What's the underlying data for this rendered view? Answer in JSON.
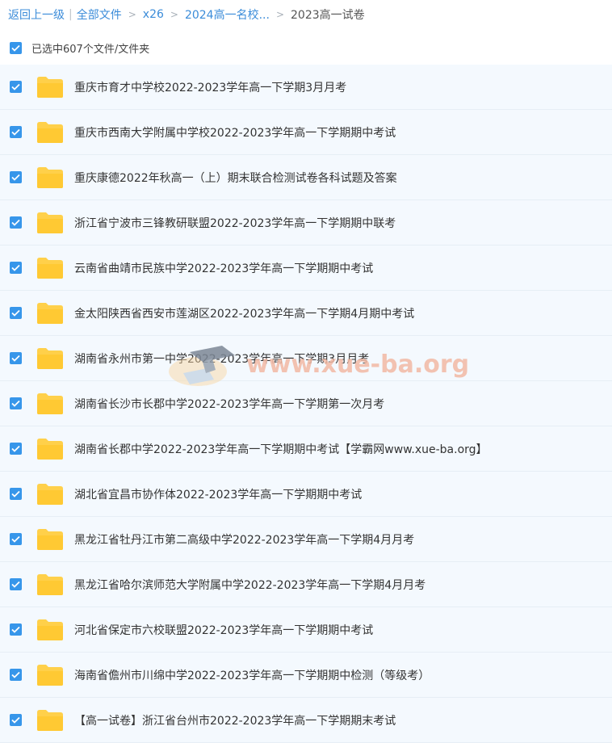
{
  "breadcrumb": {
    "back": "返回上一级",
    "all_files": "全部文件",
    "level1": "x26",
    "level2": "2024高一名校...",
    "current": "2023高一试卷",
    "separator": ">",
    "divider": "|"
  },
  "selection": {
    "count_label": "已选中607个文件/文件夹"
  },
  "files": [
    {
      "name": "重庆市育才中学校2022-2023学年高一下学期3月月考"
    },
    {
      "name": "重庆市西南大学附属中学校2022-2023学年高一下学期期中考试"
    },
    {
      "name": "重庆康德2022年秋高一（上）期末联合检测试卷各科试题及答案"
    },
    {
      "name": "浙江省宁波市三锋教研联盟2022-2023学年高一下学期期中联考"
    },
    {
      "name": "云南省曲靖市民族中学2022-2023学年高一下学期期中考试"
    },
    {
      "name": "金太阳陕西省西安市莲湖区2022-2023学年高一下学期4月期中考试"
    },
    {
      "name": "湖南省永州市第一中学2022-2023学年高一下学期3月月考"
    },
    {
      "name": "湖南省长沙市长郡中学2022-2023学年高一下学期第一次月考"
    },
    {
      "name": "湖南省长郡中学2022-2023学年高一下学期期中考试【学霸网www.xue-ba.org】"
    },
    {
      "name": "湖北省宜昌市协作体2022-2023学年高一下学期期中考试"
    },
    {
      "name": "黑龙江省牡丹江市第二高级中学2022-2023学年高一下学期4月月考"
    },
    {
      "name": "黑龙江省哈尔滨师范大学附属中学2022-2023学年高一下学期4月月考"
    },
    {
      "name": "河北省保定市六校联盟2022-2023学年高一下学期期中考试"
    },
    {
      "name": "海南省儋州市川绵中学2022-2023学年高一下学期期中检测（等级考）"
    },
    {
      "name": "【高一试卷】浙江省台州市2022-2023学年高一下学期期末考试"
    }
  ],
  "watermark": {
    "text": "www.xue-ba.org"
  },
  "colors": {
    "link": "#3b8cd9",
    "checkbox": "#3796ea",
    "folder": "#ffd04a",
    "row_bg": "#f4f9fe"
  },
  "icons": {
    "checkbox": "checkmark-icon",
    "folder": "folder-icon"
  }
}
